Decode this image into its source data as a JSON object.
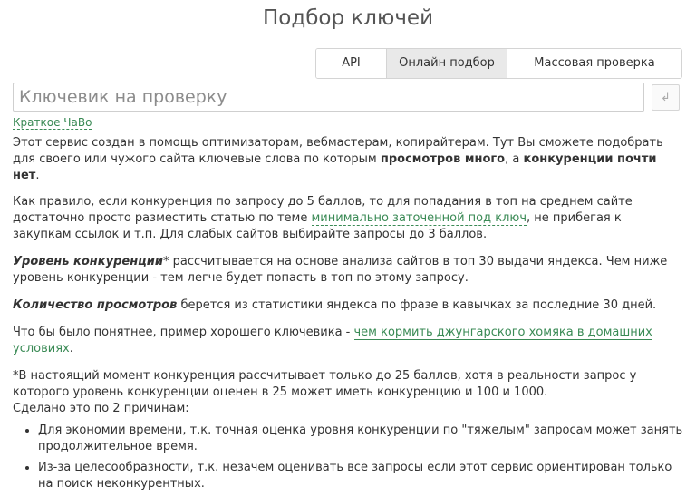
{
  "page": {
    "title": "Подбор ключей"
  },
  "tabs": [
    {
      "label": "API",
      "active": false
    },
    {
      "label": "Онлайн подбор",
      "active": true
    },
    {
      "label": "Массовая проверка",
      "active": false
    }
  ],
  "search": {
    "placeholder": "Ключевик на проверку",
    "value": "",
    "submit_icon": "enter-icon",
    "submit_glyph": "↲"
  },
  "faq_link": "Краткое ЧаВо",
  "intro": {
    "text_before": "Этот сервис создан в помощь оптимизаторам, вебмастерам, копирайтерам. Тут Вы сможете подобрать для своего или чужого сайта ключевые слова по которым ",
    "bold1": "просмотров много",
    "mid": ", а ",
    "bold2": "конкуренции почти нет",
    "end": "."
  },
  "rule": {
    "before": "Как правило, если конкуренция по запросу до 5 баллов, то для попадания в топ на среднем сайте достаточно просто разместить статью по теме ",
    "link": "минимально заточенной под ключ",
    "after": ", не прибегая к закупкам ссылок и т.п. Для слабых сайтов выбирайте запросы до 3 баллов."
  },
  "competition": {
    "term": "Уровень конкуренции",
    "rest": "* рассчитывается на основе анализа сайтов в топ 30 выдачи яндекса. Чем ниже уровень конкуренции - тем легче будет попасть в топ по этому запросу."
  },
  "views": {
    "term": "Количество просмотров",
    "rest": " берется из статистики яндекса по фразе в кавычках за последние 30 дней."
  },
  "example": {
    "before": "Что бы было понятнее, пример хорошего ключевика - ",
    "link": "чем кормить джунгарского хомяка в домашних условиях",
    "after": "."
  },
  "note": {
    "line1": "*В настоящий момент конкуренция рассчитывает только до 25 баллов, хотя в реальности запрос у которого уровень конкуренции оценен в 25 может иметь конкуренцию и 100 и 1000.",
    "line2": "Сделано это по 2 причинам:"
  },
  "reasons": [
    "Для экономии времени, т.к. точная оценка уровня конкуренции по \"тяжелым\" запросам может занять продолжительное время.",
    "Из-за целесообразности, т.к. незачем оценивать все запросы если этот сервис ориентирован только на поиск неконкурентных."
  ]
}
